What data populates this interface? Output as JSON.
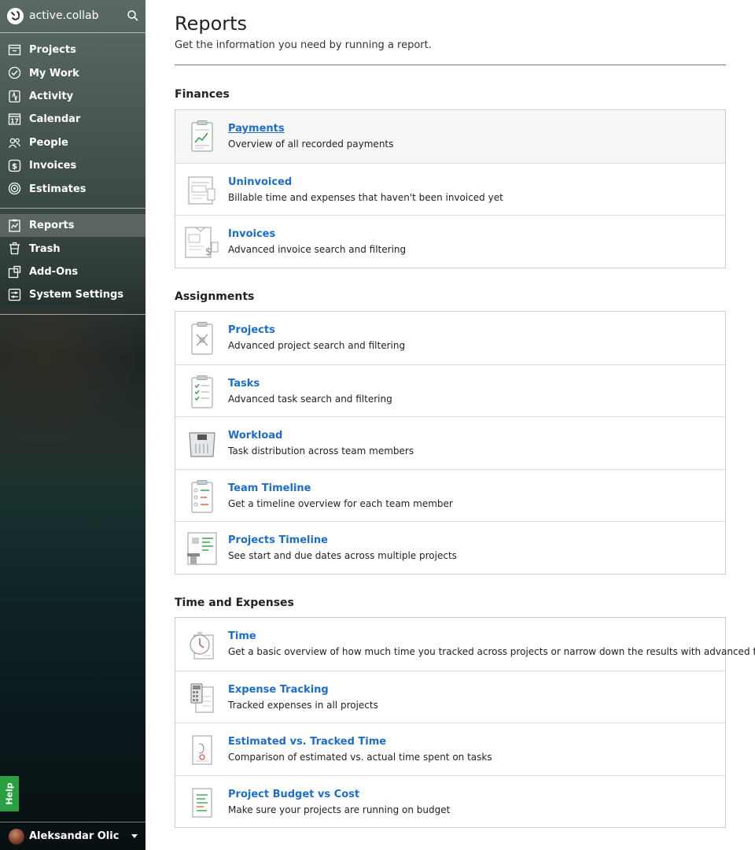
{
  "app": {
    "name": "active.collab"
  },
  "sidebar": {
    "primary": [
      {
        "label": "Projects",
        "icon": "projects-icon"
      },
      {
        "label": "My Work",
        "icon": "check-circle-icon"
      },
      {
        "label": "Activity",
        "icon": "activity-icon"
      },
      {
        "label": "Calendar",
        "icon": "calendar-icon"
      },
      {
        "label": "People",
        "icon": "people-icon"
      },
      {
        "label": "Invoices",
        "icon": "dollar-icon"
      },
      {
        "label": "Estimates",
        "icon": "target-icon"
      }
    ],
    "secondary": [
      {
        "label": "Reports",
        "icon": "reports-icon",
        "active": true
      },
      {
        "label": "Trash",
        "icon": "trash-icon"
      },
      {
        "label": "Add-Ons",
        "icon": "addons-icon"
      },
      {
        "label": "System Settings",
        "icon": "settings-icon"
      }
    ],
    "calendar_day": "17",
    "help_label": "Help",
    "user": {
      "name": "Aleksandar Olic"
    }
  },
  "page": {
    "title": "Reports",
    "subtitle": "Get the information you need by running a report."
  },
  "sections": [
    {
      "title": "Finances",
      "items": [
        {
          "title": "Payments",
          "desc": "Overview of all recorded payments",
          "icon": "payments-clipboard-icon"
        },
        {
          "title": "Uninvoiced",
          "desc": "Billable time and expenses that haven't been invoiced yet",
          "icon": "uninvoiced-document-icon"
        },
        {
          "title": "Invoices",
          "desc": "Advanced invoice search and filtering",
          "icon": "invoice-document-icon"
        }
      ]
    },
    {
      "title": "Assignments",
      "items": [
        {
          "title": "Projects",
          "desc": "Advanced project search and filtering",
          "icon": "projects-clipboard-icon"
        },
        {
          "title": "Tasks",
          "desc": "Advanced task search and filtering",
          "icon": "tasks-clipboard-icon"
        },
        {
          "title": "Workload",
          "desc": "Task distribution across team members",
          "icon": "workload-scale-icon"
        },
        {
          "title": "Team Timeline",
          "desc": "Get a timeline overview for each team member",
          "icon": "team-timeline-icon"
        },
        {
          "title": "Projects Timeline",
          "desc": "See start and due dates across multiple projects",
          "icon": "projects-timeline-icon"
        }
      ]
    },
    {
      "title": "Time and Expenses",
      "items": [
        {
          "title": "Time",
          "desc": "Get a basic overview of how much time you tracked across projects or narrow down the results with advanced filters",
          "icon": "stopwatch-icon"
        },
        {
          "title": "Expense Tracking",
          "desc": "Tracked expenses in all projects",
          "icon": "calculator-icon"
        },
        {
          "title": "Estimated vs. Tracked Time",
          "desc": "Comparison of estimated vs. actual time spent on tasks",
          "icon": "estimate-icon"
        },
        {
          "title": "Project Budget vs Cost",
          "desc": "Make sure your projects are running on budget",
          "icon": "budget-icon"
        }
      ]
    }
  ],
  "colors": {
    "link": "#1c6dce",
    "help": "#2aa043"
  }
}
